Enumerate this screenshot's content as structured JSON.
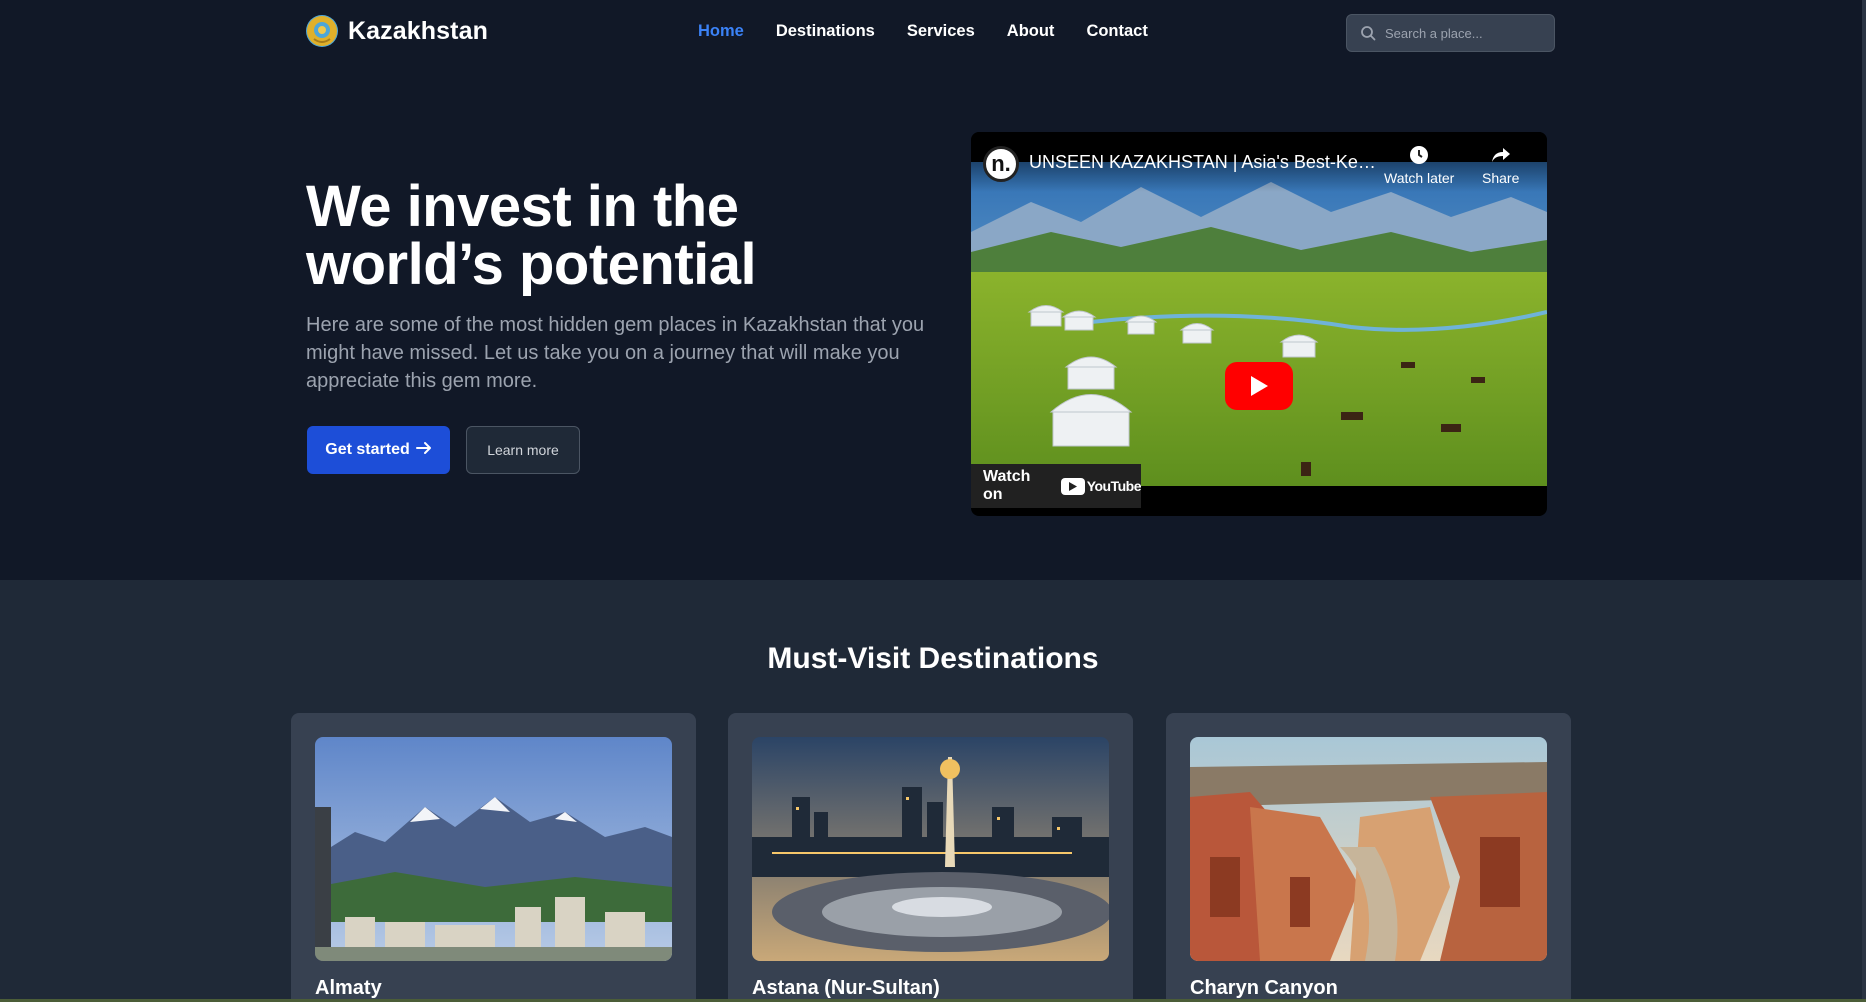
{
  "brand": {
    "name": "Kazakhstan",
    "emblem_icon": "kazakhstan-emblem-icon"
  },
  "nav": {
    "items": [
      {
        "label": "Home",
        "active": true
      },
      {
        "label": "Destinations",
        "active": false
      },
      {
        "label": "Services",
        "active": false
      },
      {
        "label": "About",
        "active": false
      },
      {
        "label": "Contact",
        "active": false
      }
    ]
  },
  "search": {
    "placeholder": "Search a place...",
    "value": "",
    "icon": "search-icon"
  },
  "hero": {
    "title": "We invest in the world’s potential",
    "description": "Here are some of the most hidden gem places in Kazakhstan that you might have missed. Let us take you on a journey that will make you appreciate this gem more.",
    "primary_button": "Get started",
    "primary_button_icon": "arrow-right-icon",
    "secondary_button": "Learn more"
  },
  "video": {
    "channel_initial": "n.",
    "title": "UNSEEN KAZAKHSTAN | Asia's Best-Kept...",
    "watch_later": "Watch later",
    "share": "Share",
    "watch_on": "Watch on",
    "youtube": "YouTube"
  },
  "destinations": {
    "heading": "Must-Visit Destinations",
    "cards": [
      {
        "title": "Almaty"
      },
      {
        "title": "Astana (Nur-Sultan)"
      },
      {
        "title": "Charyn Canyon"
      }
    ]
  },
  "colors": {
    "background": "#111827",
    "section_background": "#1f2937",
    "card_background": "#374151",
    "accent": "#3b82f6",
    "primary_button": "#1d4ed8",
    "youtube_red": "#ff0000"
  }
}
